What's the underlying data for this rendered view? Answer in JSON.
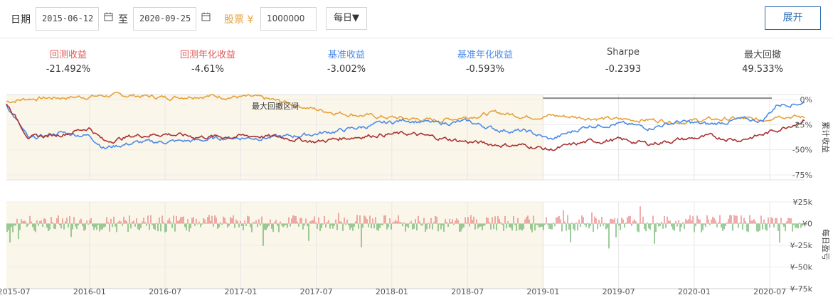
{
  "toolbar": {
    "date_label": "日期",
    "start_date": "2015-06-12",
    "to_label": "至",
    "end_date": "2020-09-25",
    "stock_label": "股票 ¥",
    "capital": "1000000",
    "frequency": "每日▼",
    "expand_label": "展开"
  },
  "stats": [
    {
      "label": "回测收益",
      "value": "-21.492%",
      "color": "#e05a5a"
    },
    {
      "label": "回测年化收益",
      "value": "-4.61%",
      "color": "#e05a5a"
    },
    {
      "label": "基准收益",
      "value": "-3.002%",
      "color": "#4c8be8"
    },
    {
      "label": "基准年化收益",
      "value": "-0.593%",
      "color": "#4c8be8"
    },
    {
      "label": "Sharpe",
      "value": "-0.2393",
      "color": "#444444"
    },
    {
      "label": "最大回撤",
      "value": "49.533%",
      "color": "#444444"
    }
  ],
  "chart_data": {
    "type": "line",
    "x_ticks": [
      "2015-07",
      "2016-01",
      "2016-07",
      "2017-01",
      "2017-07",
      "2018-01",
      "2018-07",
      "2019-01",
      "2019-07",
      "2020-01",
      "2020-07"
    ],
    "top": {
      "ylabel": "累计收益",
      "y_ticks": [
        "0%",
        "-25%",
        "-50%",
        "-75%"
      ],
      "ylim": [
        -80,
        5
      ],
      "drawdown_label": "最大回撤区间",
      "drawdown_range": [
        "2015-06",
        "2019-01"
      ],
      "x": [
        2015.45,
        2015.6,
        2015.8,
        2016.0,
        2016.1,
        2016.3,
        2016.5,
        2016.7,
        2016.9,
        2017.1,
        2017.3,
        2017.5,
        2017.7,
        2017.9,
        2018.1,
        2018.3,
        2018.5,
        2018.7,
        2018.9,
        2019.05,
        2019.3,
        2019.5,
        2019.7,
        2019.9,
        2020.1,
        2020.3,
        2020.45,
        2020.55,
        2020.73
      ],
      "series": [
        {
          "name": "",
          "color": "#e6a23c",
          "values": [
            -2,
            1,
            2,
            3,
            4,
            4,
            2,
            4,
            3,
            2,
            -3,
            -10,
            -14,
            -17,
            -19,
            -21,
            -17,
            -13,
            -17,
            -16,
            -18,
            -20,
            -20,
            -22,
            -20,
            -19,
            -21,
            -15,
            -18
          ]
        },
        {
          "name": "",
          "color": "#4c8be8",
          "values": [
            -5,
            -40,
            -33,
            -36,
            -48,
            -43,
            -42,
            -41,
            -38,
            -38,
            -37,
            -34,
            -30,
            -25,
            -20,
            -24,
            -22,
            -30,
            -32,
            -40,
            -26,
            -24,
            -28,
            -22,
            -25,
            -20,
            -21,
            -5,
            -3
          ]
        },
        {
          "name": "",
          "color": "#a83232",
          "values": [
            -3,
            -38,
            -35,
            -28,
            -42,
            -36,
            -34,
            -37,
            -37,
            -36,
            -38,
            -42,
            -38,
            -35,
            -34,
            -38,
            -42,
            -45,
            -46,
            -50,
            -42,
            -40,
            -44,
            -40,
            -37,
            -40,
            -35,
            -30,
            -20
          ]
        }
      ]
    },
    "bottom": {
      "ylabel": "每日盈亏",
      "y_ticks": [
        "¥25k",
        "¥0",
        "¥-25k",
        "¥-50k",
        "¥-75k"
      ],
      "ylim": [
        -75,
        25
      ],
      "pos_color": "#e05a5a",
      "neg_color": "#3a9a3a"
    }
  }
}
